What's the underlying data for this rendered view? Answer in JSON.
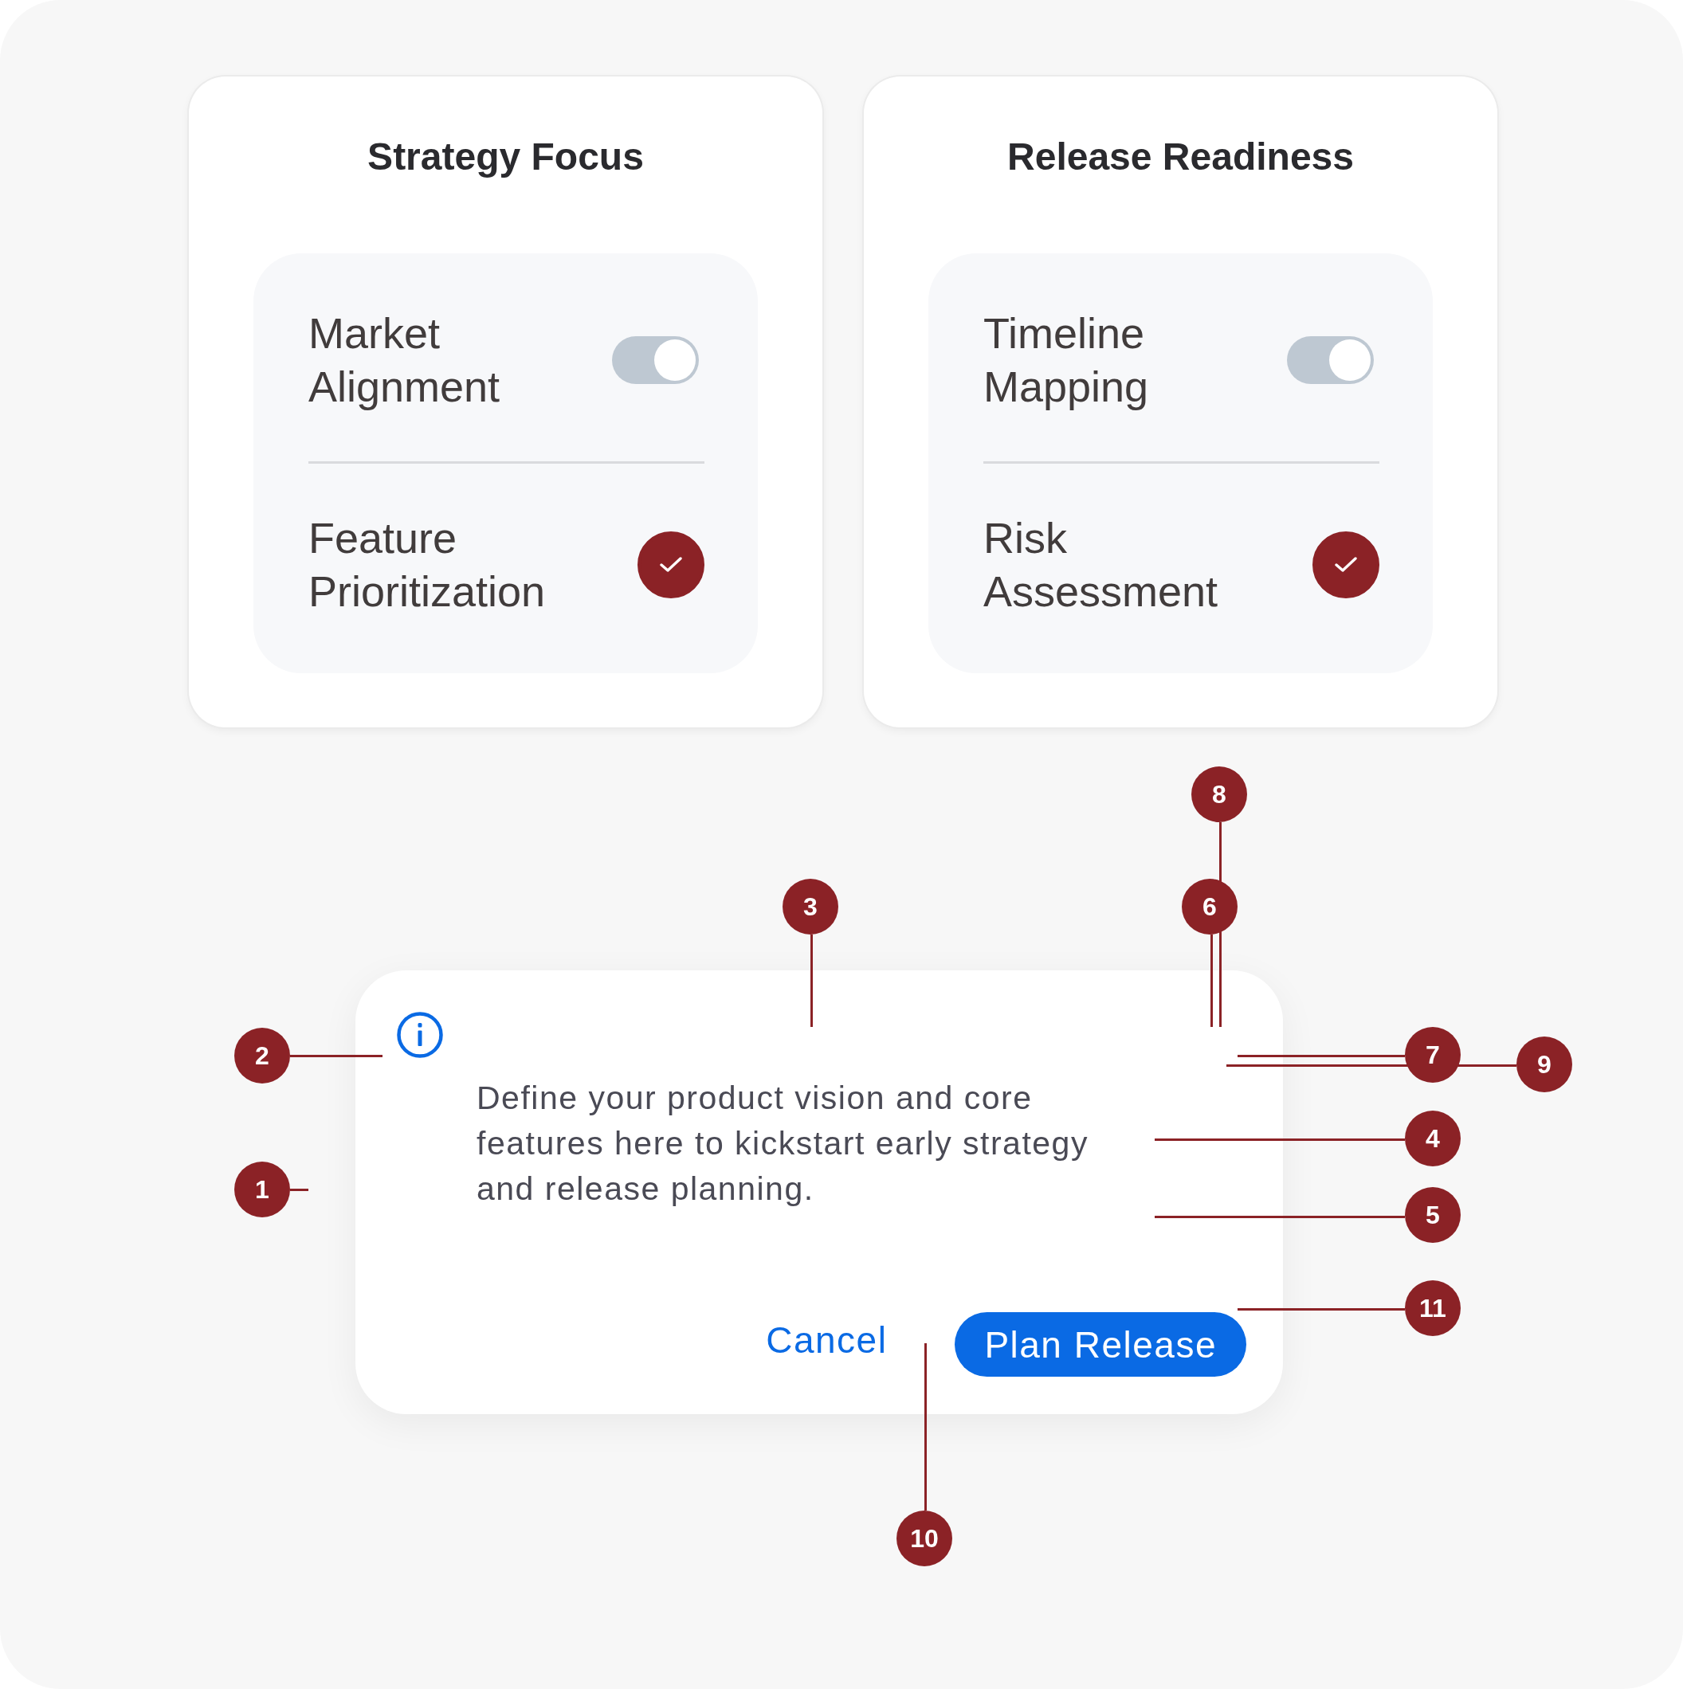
{
  "cards": [
    {
      "title": "Strategy Focus",
      "items": [
        {
          "label": "Market Alignment",
          "kind": "toggle",
          "on": true
        },
        {
          "label": "Feature Prioritization",
          "kind": "check",
          "checked": true
        }
      ]
    },
    {
      "title": "Release Readiness",
      "items": [
        {
          "label": "Timeline Mapping",
          "kind": "toggle",
          "on": true
        },
        {
          "label": "Risk Assessment",
          "kind": "check",
          "checked": true
        }
      ]
    }
  ],
  "dialog": {
    "message": "Define your product vision and core features here to kickstart early strategy and release planning.",
    "buttons": [
      {
        "label": "Cancel",
        "kind": "text"
      },
      {
        "label": "Plan Release",
        "kind": "filled"
      }
    ]
  },
  "callouts": [
    {
      "label": "1"
    },
    {
      "label": "2"
    },
    {
      "label": "3"
    },
    {
      "label": "4"
    },
    {
      "label": "5"
    },
    {
      "label": "6"
    },
    {
      "label": "7"
    },
    {
      "label": "8"
    },
    {
      "label": "9"
    },
    {
      "label": "10"
    },
    {
      "label": "11"
    }
  ]
}
